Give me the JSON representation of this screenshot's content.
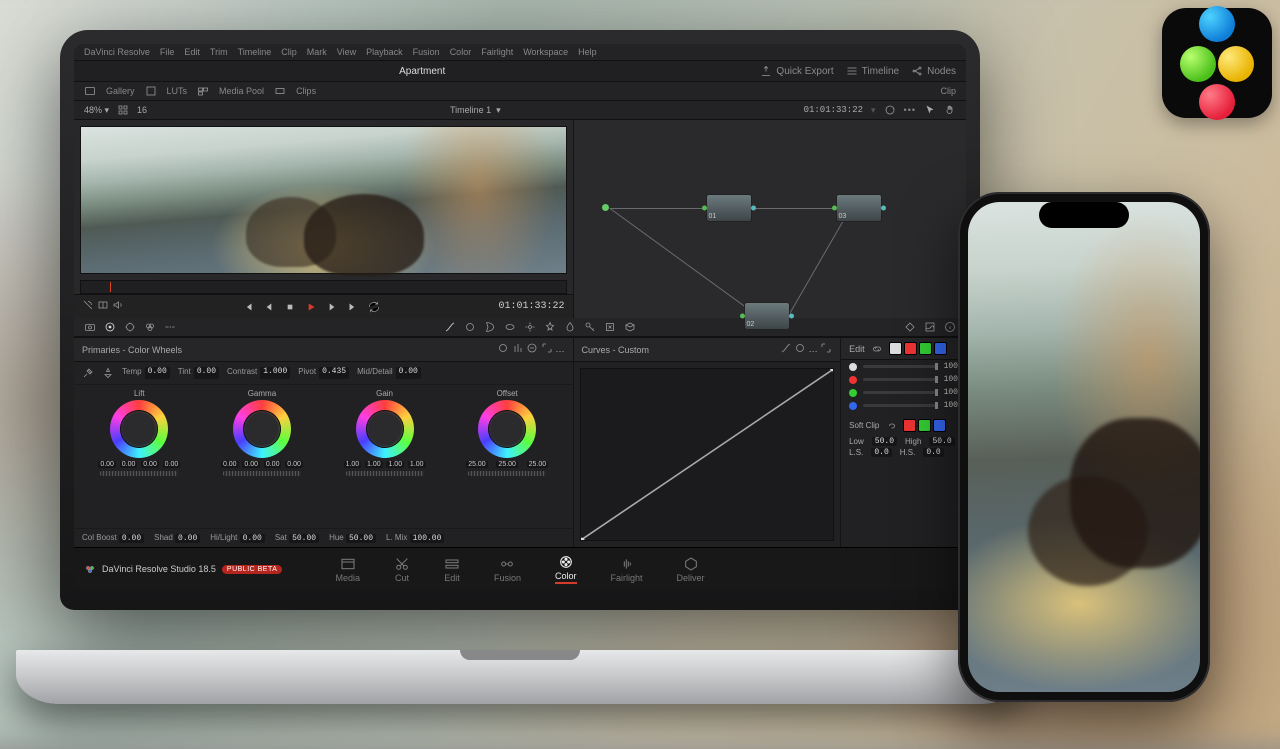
{
  "menubar": [
    "DaVinci Resolve",
    "File",
    "Edit",
    "Trim",
    "Timeline",
    "Clip",
    "Mark",
    "View",
    "Playback",
    "Fusion",
    "Color",
    "Fairlight",
    "Workspace",
    "Help"
  ],
  "titlebar": {
    "project": "Apartment",
    "right": {
      "quick_export": "Quick Export",
      "timeline": "Timeline",
      "nodes": "Nodes"
    }
  },
  "tabbar": {
    "gallery": "Gallery",
    "luts": "LUTs",
    "mediapool": "Media Pool",
    "clips": "Clips",
    "right_clip": "Clip"
  },
  "ctrl": {
    "zoom": "48%",
    "fit": "16",
    "timeline_name": "Timeline 1",
    "timecode": "01:01:33:22"
  },
  "transport": {
    "timecode": "01:01:33:22"
  },
  "nodes": {
    "n1": "01",
    "n2": "02",
    "n3": "03"
  },
  "primaries": {
    "title": "Primaries - Color Wheels",
    "params": {
      "temp_label": "Temp",
      "temp": "0.00",
      "tint_label": "Tint",
      "tint": "0.00",
      "contrast_label": "Contrast",
      "contrast": "1.000",
      "pivot_label": "Pivot",
      "pivot": "0.435",
      "middetail_label": "Mid/Detail",
      "middetail": "0.00"
    },
    "wheels": {
      "lift": {
        "label": "Lift",
        "v": [
          "0.00",
          "0.00",
          "0.00",
          "0.00"
        ]
      },
      "gamma": {
        "label": "Gamma",
        "v": [
          "0.00",
          "0.00",
          "0.00",
          "0.00"
        ]
      },
      "gain": {
        "label": "Gain",
        "v": [
          "1.00",
          "1.00",
          "1.00",
          "1.00"
        ]
      },
      "offset": {
        "label": "Offset",
        "v": [
          "25.00",
          "25.00",
          "25.00"
        ]
      }
    },
    "bottom": {
      "colboost_label": "Col Boost",
      "colboost": "0.00",
      "shad_label": "Shad",
      "shad": "0.00",
      "hilight_label": "Hi/Light",
      "hilight": "0.00",
      "sat_label": "Sat",
      "sat": "50.00",
      "hue_label": "Hue",
      "hue": "50.00",
      "lmix_label": "L. Mix",
      "lmix": "100.00"
    }
  },
  "curves": {
    "title": "Curves - Custom"
  },
  "edit": {
    "label": "Edit",
    "channels": [
      {
        "name": "Y",
        "val": "100"
      },
      {
        "name": "R",
        "val": "100"
      },
      {
        "name": "G",
        "val": "100"
      },
      {
        "name": "B",
        "val": "100"
      }
    ],
    "softclip_label": "Soft Clip",
    "low_label": "Low",
    "low": "50.0",
    "high_label": "High",
    "high": "50.0",
    "ls_label": "L.S.",
    "ls": "0.0",
    "hs_label": "H.S.",
    "hs": "0.0"
  },
  "pages": {
    "brand": "DaVinci Resolve Studio 18.5",
    "beta": "PUBLIC BETA",
    "tabs": [
      "Media",
      "Cut",
      "Edit",
      "Fusion",
      "Color",
      "Fairlight",
      "Deliver"
    ],
    "active": "Color"
  }
}
